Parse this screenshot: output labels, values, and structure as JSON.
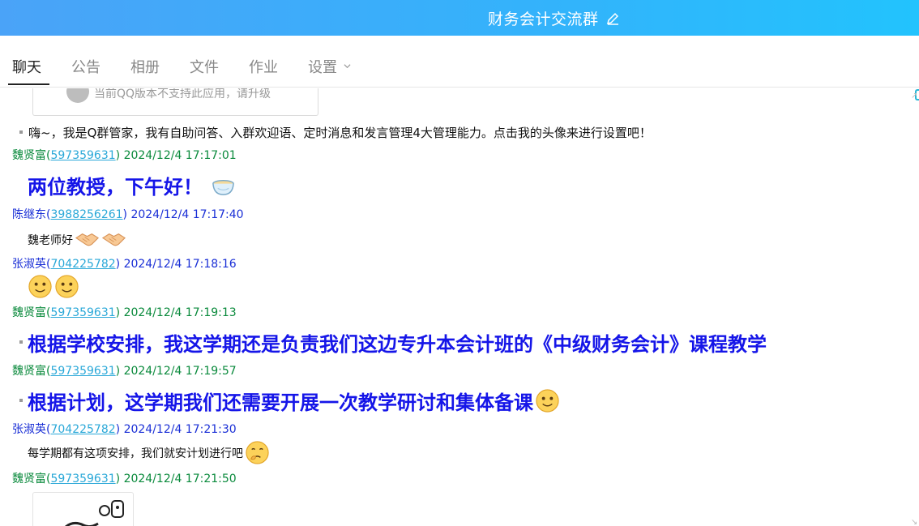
{
  "window": {
    "title": "财务会计交流群"
  },
  "tabs": [
    {
      "label": "聊天"
    },
    {
      "label": "公告"
    },
    {
      "label": "相册"
    },
    {
      "label": "文件"
    },
    {
      "label": "作业"
    },
    {
      "label": "设置"
    }
  ],
  "card_top": {
    "text": "当前QQ版本不支持此应用，请升级"
  },
  "system_message": "嗨~，我是Q群管家，我有自助问答、入群欢迎语、定时消息和发言管理4大管理能力。点击我的头像来进行设置吧！",
  "messages": [
    {
      "name": "魏贤富",
      "qq": "597359631",
      "time": "2024/12/4 17:17:01",
      "text": "两位教授，下午好！",
      "emoji": "tea-bowl"
    },
    {
      "name": "陈继东",
      "qq": "3988256261",
      "time": "2024/12/4 17:17:40",
      "text": "魏老师好",
      "emoji": "handshake"
    },
    {
      "name": "张淑英",
      "qq": "704225782",
      "time": "2024/12/4 17:18:16",
      "text": "",
      "emoji": "smile"
    },
    {
      "name": "魏贤富",
      "qq": "597359631",
      "time": "2024/12/4 17:19:13",
      "text": "根据学校安排，我这学期还是负责我们这边专升本会计班的《中级财务会计》课程教学",
      "emoji": ""
    },
    {
      "name": "魏贤富",
      "qq": "597359631",
      "time": "2024/12/4 17:19:57",
      "text": "根据计划，这学期我们还需要开展一次教学研讨和集体备课",
      "emoji": "smile"
    },
    {
      "name": "张淑英",
      "qq": "704225782",
      "time": "2024/12/4 17:21:30",
      "text": "每学期都有这项安排，我们就安计划进行吧",
      "emoji": "thinking"
    },
    {
      "name": "魏贤富",
      "qq": "597359631",
      "time": "2024/12/4 17:21:50",
      "text": "",
      "emoji": ""
    }
  ],
  "colors": {
    "titlebar_start": "#4aa3f8",
    "titlebar_end": "#22c3fd",
    "sender_green": "#0a8a3c",
    "sender_blue": "#1a2fd6",
    "big_text": "#1515e8",
    "qq_link": "#2aa8d8"
  }
}
